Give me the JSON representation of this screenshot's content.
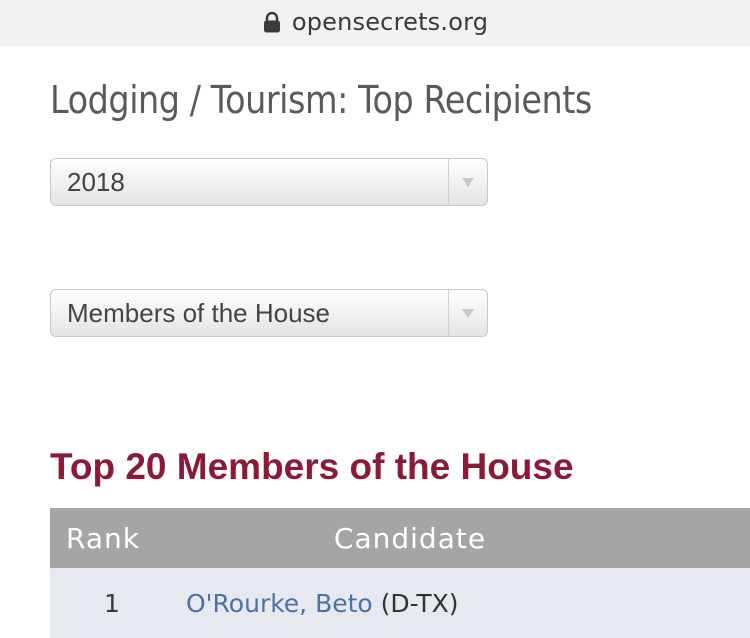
{
  "browser": {
    "url": "opensecrets.org",
    "lock_icon": "lock-icon"
  },
  "page": {
    "title": "Lodging / Tourism: Top Recipients"
  },
  "filters": {
    "cycle": {
      "selected": "2018"
    },
    "chamber": {
      "selected": "Members of the House"
    }
  },
  "section": {
    "heading": "Top 20 Members of the House"
  },
  "table": {
    "columns": [
      "Rank",
      "Candidate"
    ],
    "rows": [
      {
        "rank": "1",
        "name": "O'Rourke, Beto",
        "party": "(D-TX)"
      }
    ]
  },
  "colors": {
    "heading": "#8b1a36",
    "link": "#4a72a8",
    "table_header_bg": "#a5a5a5",
    "row_bg": "#e6e9ef"
  }
}
